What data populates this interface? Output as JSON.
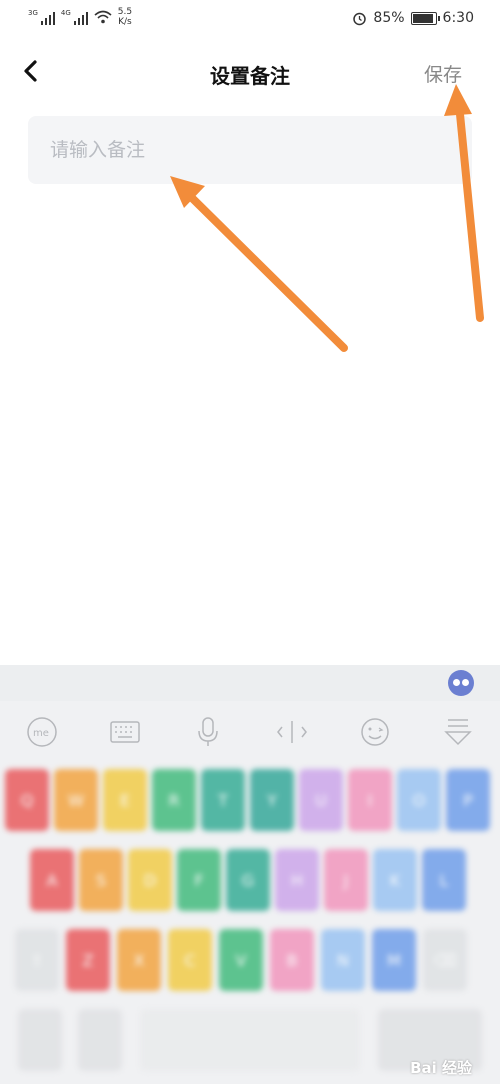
{
  "status_bar": {
    "net1": "3G",
    "net2": "4G",
    "speed_value": "5.5",
    "speed_unit": "K/s",
    "battery": "85%",
    "time": "6:30",
    "battery_level": 0.85
  },
  "header": {
    "title": "设置备注",
    "save_label": "保存"
  },
  "remark_input": {
    "placeholder": "请输入备注",
    "value": ""
  },
  "keyboard": {
    "tools": [
      "ime-logo-icon",
      "keyboard-icon",
      "microphone-icon",
      "cursor-icon",
      "emoji-icon",
      "collapse-icon"
    ],
    "row1": [
      "Q",
      "W",
      "E",
      "R",
      "T",
      "Y",
      "U",
      "I",
      "O",
      "P"
    ],
    "row2": [
      "A",
      "S",
      "D",
      "F",
      "G",
      "H",
      "J",
      "K",
      "L"
    ],
    "row3": [
      "⇧",
      "Z",
      "X",
      "C",
      "V",
      "B",
      "N",
      "M",
      "⌫"
    ],
    "row1_colors": [
      "#e8474a",
      "#f39a2a",
      "#f2c632",
      "#2db36e",
      "#1fa38a",
      "#1e9e8e",
      "#c79be8",
      "#f28ab6",
      "#8fbdf2",
      "#5f93e8"
    ],
    "row2_colors": [
      "#e8474a",
      "#f39a2a",
      "#f2c632",
      "#2db36e",
      "#1fa38a",
      "#c79be8",
      "#f28ab6",
      "#8fbdf2",
      "#5f93e8"
    ],
    "row3_colors": [
      "#dddfe2",
      "#e8474a",
      "#f39a2a",
      "#f2c632",
      "#2db36e",
      "#f28ab6",
      "#8fbdf2",
      "#5f93e8",
      "#dddfe2"
    ]
  },
  "watermark": "Bai 经验",
  "annotation_color": "#f28c3a"
}
